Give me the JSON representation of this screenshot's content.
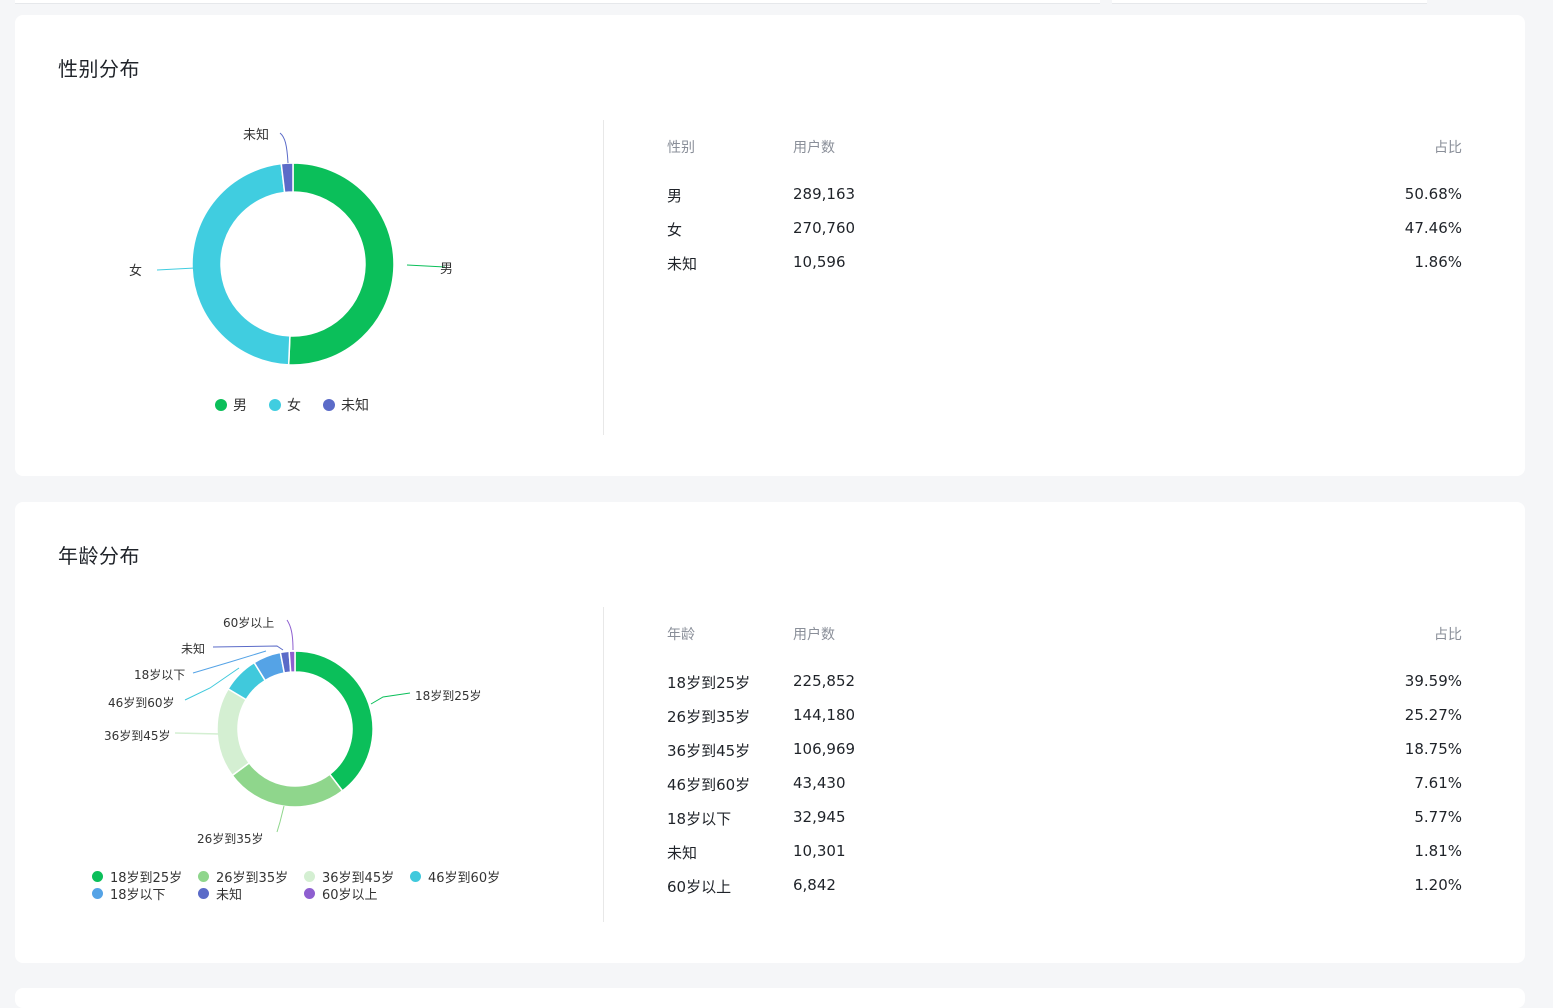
{
  "gender_section": {
    "title": "性别分布",
    "table_headers": {
      "category": "性别",
      "users": "用户数",
      "ratio": "占比"
    },
    "rows": [
      {
        "label": "男",
        "count": "289,163",
        "ratio": "50.68%"
      },
      {
        "label": "女",
        "count": "270,760",
        "ratio": "47.46%"
      },
      {
        "label": "未知",
        "count": "10,596",
        "ratio": "1.86%"
      }
    ],
    "chart_labels": {
      "male": "男",
      "female": "女",
      "unknown": "未知"
    },
    "legend": [
      {
        "label": "男",
        "color": "#0bbf5a"
      },
      {
        "label": "女",
        "color": "#40cde0"
      },
      {
        "label": "未知",
        "color": "#5b6bc8"
      }
    ]
  },
  "age_section": {
    "title": "年龄分布",
    "table_headers": {
      "category": "年龄",
      "users": "用户数",
      "ratio": "占比"
    },
    "rows": [
      {
        "label": "18岁到25岁",
        "count": "225,852",
        "ratio": "39.59%"
      },
      {
        "label": "26岁到35岁",
        "count": "144,180",
        "ratio": "25.27%"
      },
      {
        "label": "36岁到45岁",
        "count": "106,969",
        "ratio": "18.75%"
      },
      {
        "label": "46岁到60岁",
        "count": "43,430",
        "ratio": "7.61%"
      },
      {
        "label": "18岁以下",
        "count": "32,945",
        "ratio": "5.77%"
      },
      {
        "label": "未知",
        "count": "10,301",
        "ratio": "1.81%"
      },
      {
        "label": "60岁以上",
        "count": "6,842",
        "ratio": "1.20%"
      }
    ],
    "legend": [
      {
        "label": "18岁到25岁",
        "color": "#0bbf5a"
      },
      {
        "label": "26岁到35岁",
        "color": "#8fd68c"
      },
      {
        "label": "36岁到45岁",
        "color": "#d4efd2"
      },
      {
        "label": "46岁到60岁",
        "color": "#40c9dc"
      },
      {
        "label": "18岁以下",
        "color": "#55a3e6"
      },
      {
        "label": "未知",
        "color": "#5b6bc8"
      },
      {
        "label": "60岁以上",
        "color": "#8e5fd0"
      }
    ]
  },
  "chart_data": [
    {
      "type": "pie",
      "donut": true,
      "categories": [
        "男",
        "女",
        "未知"
      ],
      "values": [
        289163,
        270760,
        10596
      ],
      "colors": [
        "#0bbf5a",
        "#40cde0",
        "#5b6bc8"
      ],
      "legend": "bottom"
    },
    {
      "type": "pie",
      "donut": true,
      "categories": [
        "18岁到25岁",
        "26岁到35岁",
        "36岁到45岁",
        "46岁到60岁",
        "18岁以下",
        "未知",
        "60岁以上"
      ],
      "values": [
        225852,
        144180,
        106969,
        43430,
        32945,
        10301,
        6842
      ],
      "colors": [
        "#0bbf5a",
        "#8fd68c",
        "#d4efd2",
        "#40c9dc",
        "#55a3e6",
        "#5b6bc8",
        "#8e5fd0"
      ],
      "legend": "bottom"
    }
  ]
}
